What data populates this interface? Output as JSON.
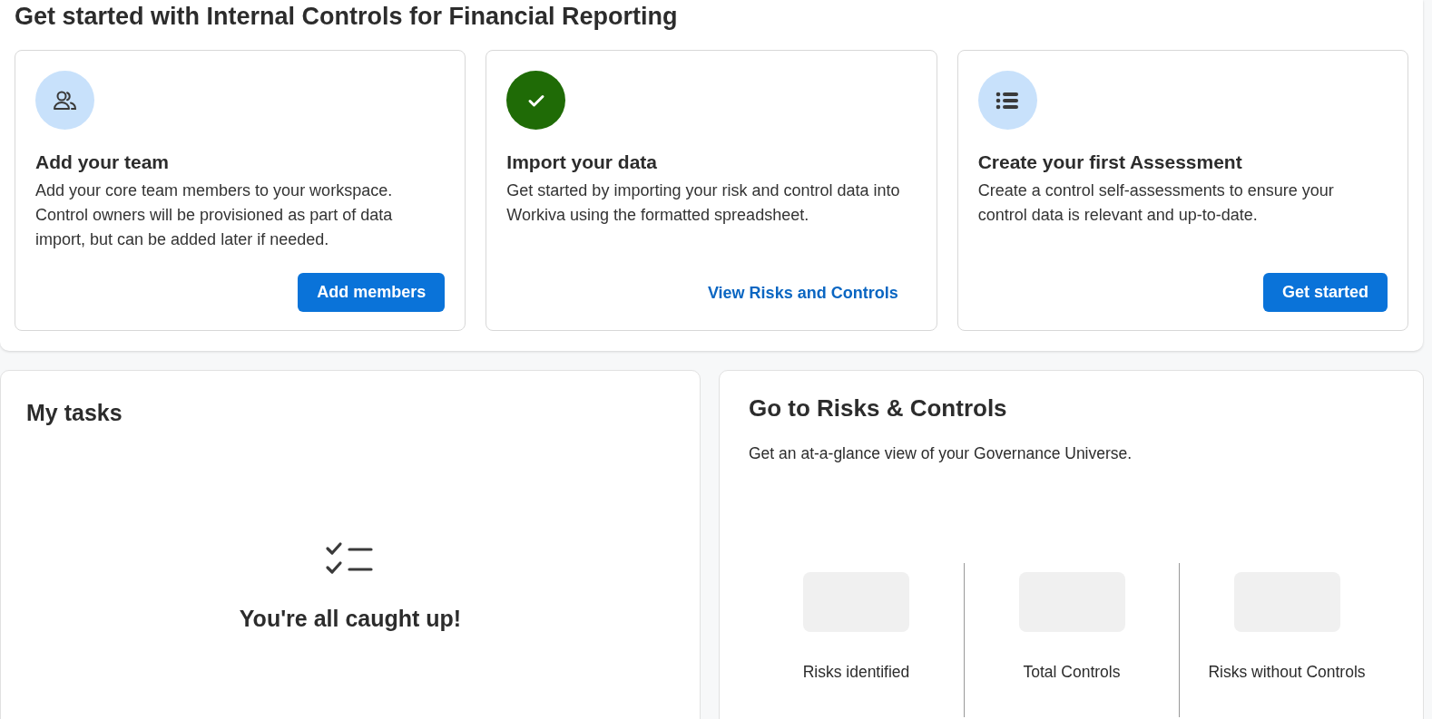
{
  "title": "Get started with Internal Controls for Financial Reporting",
  "steps": [
    {
      "completed": false,
      "heading": "Add your team",
      "text": "Add your core team members to your workspace. Control owners will be provisioned as part of data import, but can be added later if needed.",
      "action": {
        "kind": "button",
        "label": "Add members"
      }
    },
    {
      "completed": true,
      "heading": "Import your data",
      "text": "Get started by importing your risk and control data into Workiva using the formatted spreadsheet.",
      "action": {
        "kind": "link",
        "label": "View Risks and Controls"
      }
    },
    {
      "completed": false,
      "heading": "Create your first Assessment",
      "text": "Create a control self-assessments to ensure your control data is relevant and up-to-date.",
      "action": {
        "kind": "button",
        "label": "Get started"
      }
    }
  ],
  "tasks": {
    "title": "My tasks",
    "empty_message": "You're all caught up!"
  },
  "risks": {
    "title": "Go to Risks & Controls",
    "subtitle": "Get an at-a-glance view of your Governance Universe.",
    "metrics": [
      {
        "label": "Risks identified"
      },
      {
        "label": "Total Controls"
      },
      {
        "label": "Risks without Controls"
      }
    ]
  }
}
